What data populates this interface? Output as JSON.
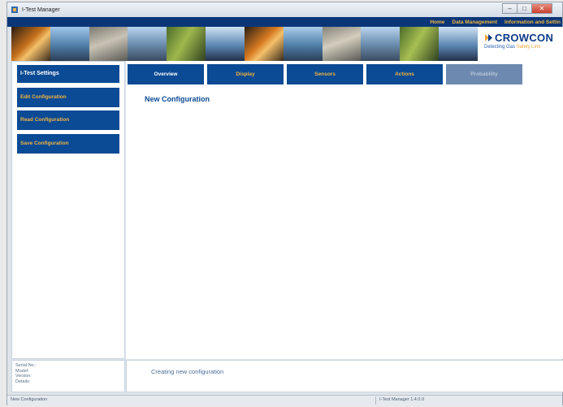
{
  "window": {
    "title": "I-Test Manager",
    "controls": {
      "minimize": "–",
      "maximize": "□",
      "close": "✕"
    }
  },
  "topnav": [
    "Home",
    "Data Management",
    "Information and Settin"
  ],
  "brand": {
    "name": "CROWCON",
    "tagline_prefix": "Detecting Gas ",
    "tagline_suffix": "Safely Limi",
    "logo_icon": "arrow-logo-icon"
  },
  "sidebar": {
    "header": "I-Test Settings",
    "buttons": [
      "Edit Configuration",
      "Read Configuration",
      "Save Configuration"
    ]
  },
  "tabs": [
    {
      "label": "Overview",
      "state": "active"
    },
    {
      "label": "Display",
      "state": "normal"
    },
    {
      "label": "Sensors",
      "state": "normal"
    },
    {
      "label": "Actions",
      "state": "normal"
    },
    {
      "label": "Probability",
      "state": "disabled"
    }
  ],
  "main": {
    "title": "New Configuration"
  },
  "info": {
    "fields": [
      "Serial No.:",
      "Model:",
      "Version:",
      "Details:"
    ],
    "message": "Creating new configuration"
  },
  "status": {
    "left": "New Configuration",
    "right": "I-Test Manager 1.4.0.0"
  },
  "colors": {
    "nav_blue": "#0b4a94",
    "accent_orange": "#f0b443",
    "brand_blue": "#0a3a86"
  }
}
